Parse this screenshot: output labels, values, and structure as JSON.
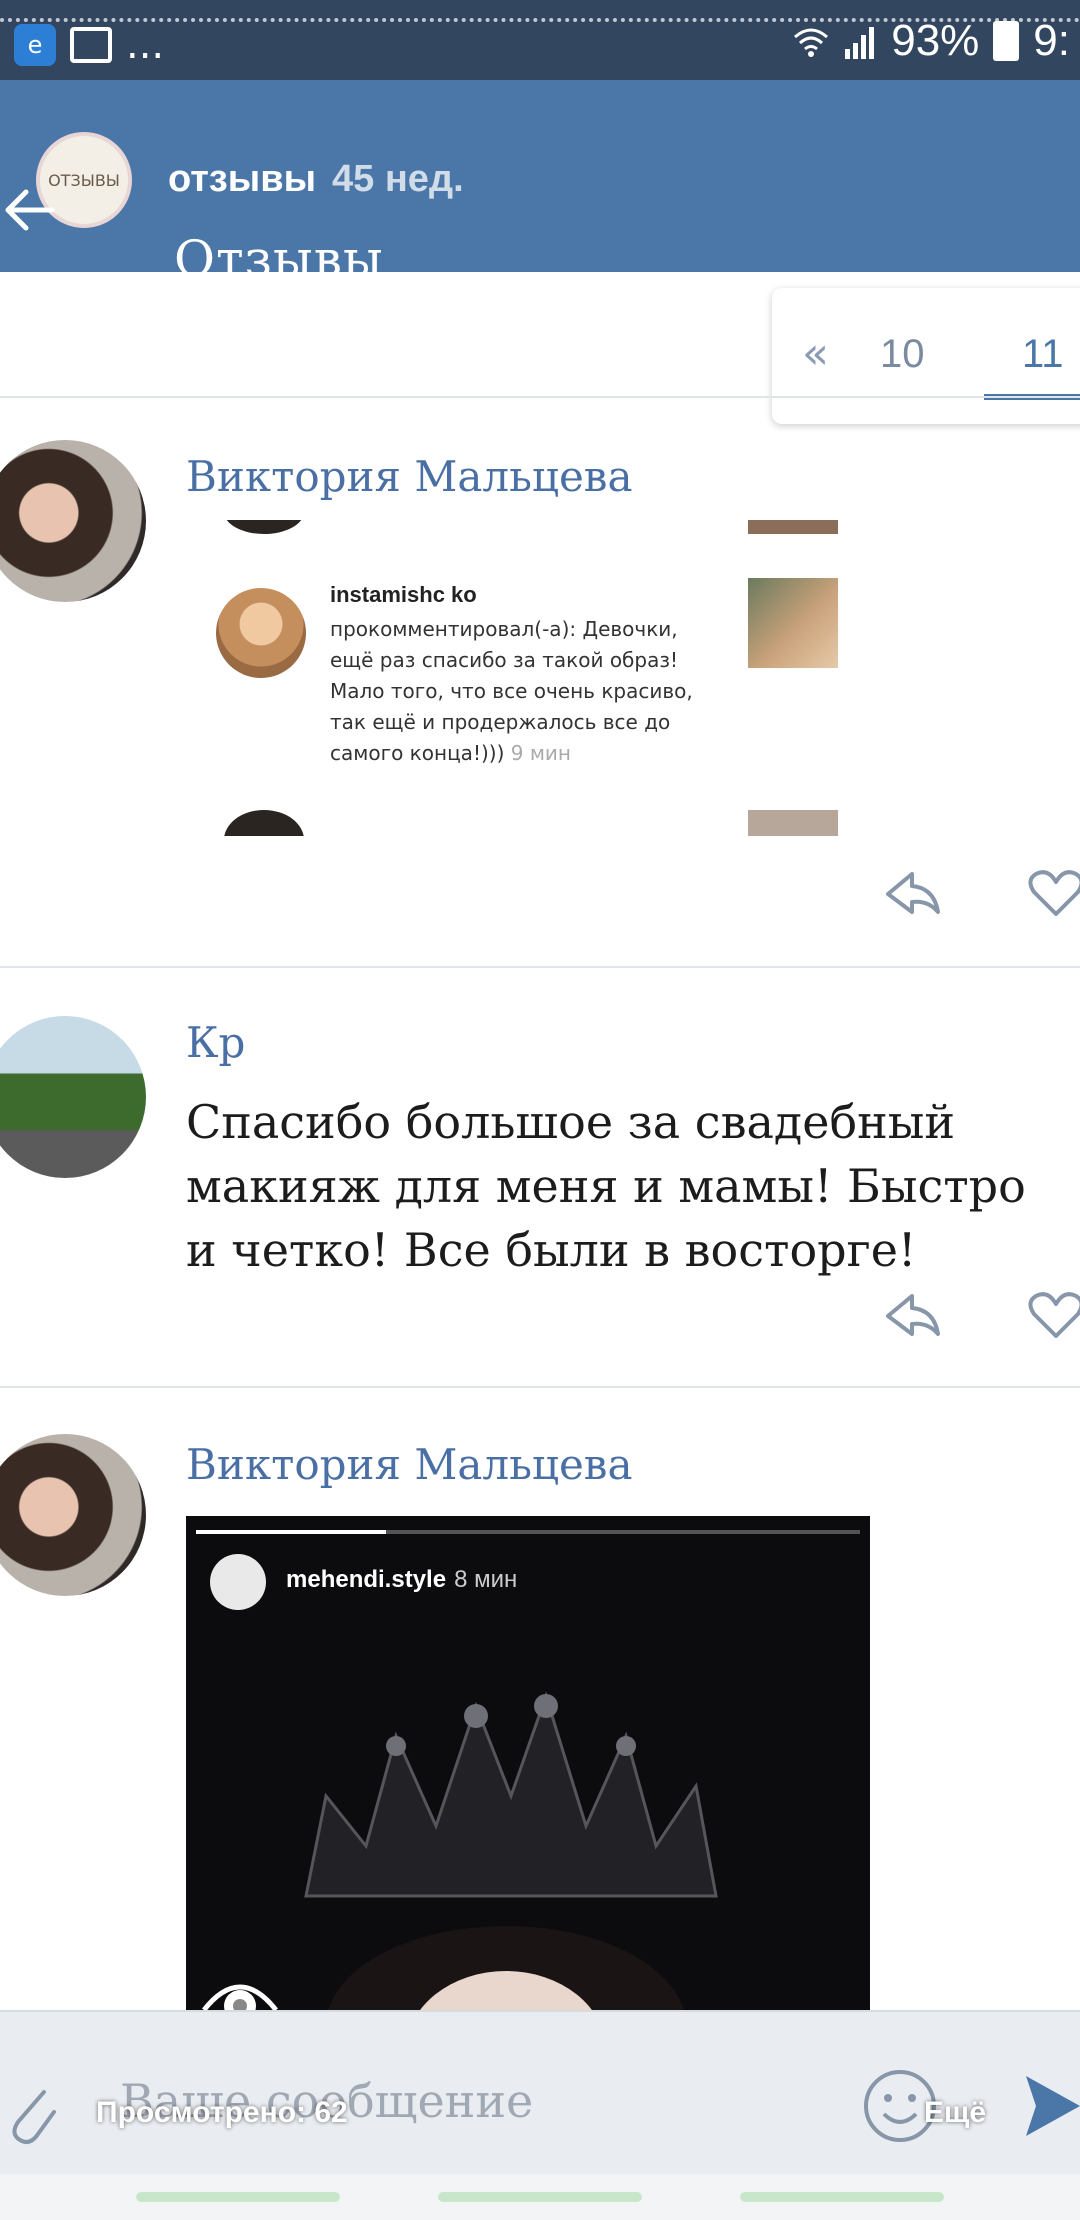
{
  "status_bar": {
    "app_icon": "browser-icon",
    "image_icon": "image-icon",
    "overflow": "...",
    "wifi_icon": "wifi-icon",
    "signal_icon": "signal-icon",
    "battery_percent": "93%",
    "clock": "9:"
  },
  "story_header": {
    "avatar_text": "ОТЗЫВЫ",
    "title": "отзывы",
    "time": "45 нед."
  },
  "header": {
    "title": "Отзывы",
    "back_icon": "back-arrow-icon"
  },
  "pagination": {
    "prev": "«",
    "pages": [
      "10",
      "11"
    ],
    "current": "11"
  },
  "posts": [
    {
      "author": "Виктория Мальцева",
      "screenshot": {
        "username": "instamishc     ko",
        "text": "прокомментировал(-а): Девочки, ещё раз спасибо за такой образ! Мало того, что все очень красиво, так ещё и продержалось все до самого конца!)))",
        "time": "9 мин"
      }
    },
    {
      "author": "Кр",
      "text": "Спасибо большое за свадебный макияж для меня и мамы! Быстро и четко! Все были в восторге!"
    },
    {
      "author": "Виктория Мальцева",
      "story": {
        "username": "mehendi.style",
        "time": "8 мин"
      }
    }
  ],
  "actions": {
    "reply_icon": "reply-icon",
    "like_icon": "heart-icon"
  },
  "composer": {
    "placeholder": "Ваше сообщение",
    "viewed": "Просмотрено: 62",
    "more": "Ещё"
  },
  "colors": {
    "accent": "#4a76a8",
    "status_bar": "#33465f",
    "author": "#4a6fa5"
  }
}
